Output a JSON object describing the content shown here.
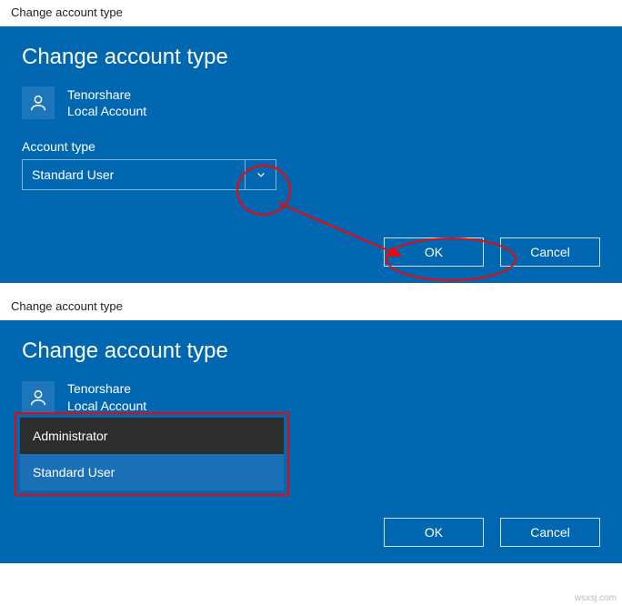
{
  "window1": {
    "title": "Change account type",
    "panel_title": "Change account type",
    "user": {
      "name": "Tenorshare",
      "sub": "Local Account"
    },
    "field_label": "Account type",
    "dropdown_value": "Standard User",
    "ok_label": "OK",
    "cancel_label": "Cancel"
  },
  "window2": {
    "title": "Change account type",
    "panel_title": "Change account type",
    "user": {
      "name": "Tenorshare",
      "sub": "Local Account"
    },
    "options": {
      "admin": "Administrator",
      "std": "Standard User"
    },
    "ok_label": "OK",
    "cancel_label": "Cancel"
  },
  "watermark": "wsxsj.com"
}
